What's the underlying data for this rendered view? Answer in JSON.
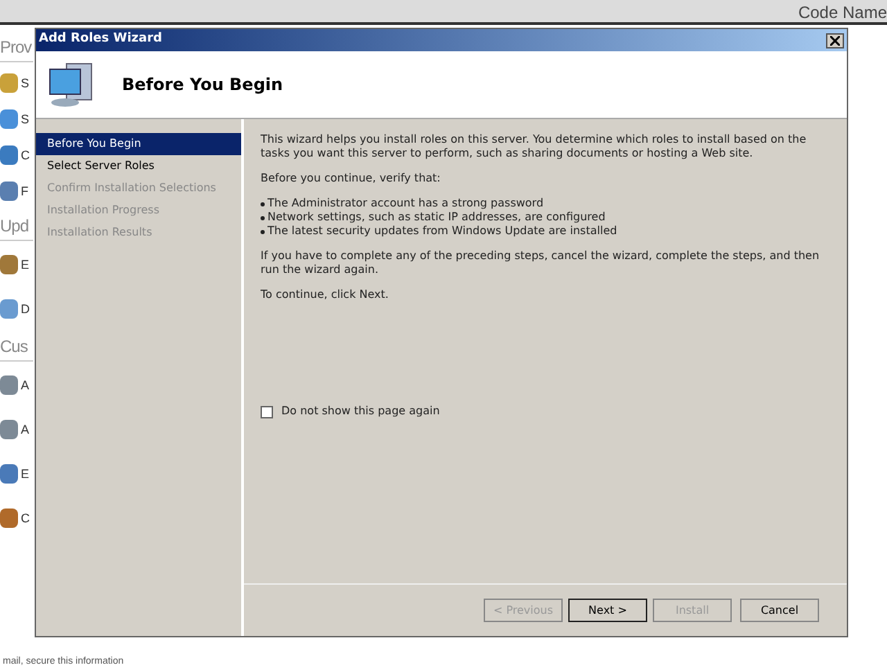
{
  "background_page": {
    "header_right": "Code Name",
    "sections": [
      {
        "title": "Prov",
        "items": [
          "S",
          "S",
          "C",
          "F"
        ]
      },
      {
        "title": "Upd",
        "items": [
          "E",
          "D"
        ]
      },
      {
        "title": "Cus",
        "items": [
          "A",
          "A",
          "E",
          "C"
        ]
      }
    ],
    "footer": "mail, secure this information"
  },
  "window": {
    "title": "Add Roles Wizard",
    "heading": "Before You Begin"
  },
  "steps": [
    {
      "label": "Before You Begin",
      "selected": true,
      "disabled": false
    },
    {
      "label": "Select Server Roles",
      "selected": false,
      "disabled": false
    },
    {
      "label": "Confirm Installation Selections",
      "selected": false,
      "disabled": true
    },
    {
      "label": "Installation Progress",
      "selected": false,
      "disabled": true
    },
    {
      "label": "Installation Results",
      "selected": false,
      "disabled": true
    }
  ],
  "content": {
    "intro": "This wizard helps you install roles on this server. You determine which roles to install based on the tasks you want this server to perform, such as sharing documents or hosting a Web site.",
    "verify": "Before you continue, verify that:",
    "bullets": [
      "The Administrator account has a strong password",
      "Network settings, such as static IP addresses, are configured",
      "The latest security updates from Windows Update are installed"
    ],
    "preceding": "If you have to complete any of the preceding steps, cancel the wizard, complete the steps, and then run the wizard again.",
    "continue": "To continue, click Next."
  },
  "checkbox": {
    "label": "Do not show this page again",
    "checked": false
  },
  "buttons": [
    {
      "label": "< Previous",
      "disabled": true,
      "default": false
    },
    {
      "label": "Next >",
      "disabled": false,
      "default": true
    },
    {
      "label": "Install",
      "disabled": true,
      "default": false
    },
    {
      "label": "Cancel",
      "disabled": false,
      "default": false
    }
  ]
}
